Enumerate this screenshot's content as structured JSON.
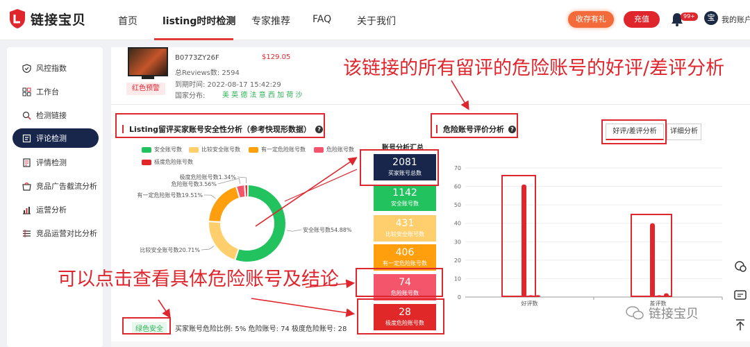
{
  "brand": {
    "name": "链接宝贝"
  },
  "nav": {
    "items": [
      "首页",
      "listing时时检测",
      "专家推荐",
      "FAQ",
      "关于我们"
    ],
    "save_label": "收存有礼",
    "charge_label": "充值",
    "badge": "99+",
    "avatar_char": "宝",
    "account_label": "我的账户"
  },
  "sidebar": {
    "items": [
      "风控指数",
      "工作台",
      "检测链接",
      "评论检测",
      "评情检测",
      "竞品广告截流分析",
      "运营分析",
      "竞品运营对比分析"
    ],
    "active_index": 3
  },
  "product": {
    "asin": "B0773ZY26F",
    "price": "$129.05",
    "reviews": "总Reviews数: 2594",
    "date": "到期时间: 2022-08-17 15:42:29",
    "country": "国家分布:",
    "flags": "美 英 德 法 意 西 加 荷 沙",
    "warning_tag": "红色预警"
  },
  "section_left": {
    "title": "Listing留评买家账号安全性分析（参考快现形数据）",
    "help": "?"
  },
  "section_right": {
    "title": "危险账号评价分析",
    "help": "?",
    "tab_good_bad": "好评/差评分析",
    "tab_detail": "详细分析"
  },
  "colors": {
    "safe": "#22c35e",
    "fairly_safe": "#ffcf6e",
    "some_risk": "#ff9f0e",
    "risk": "#f5556b",
    "extreme": "#e02828",
    "total": "#17264a",
    "accent": "#e0262d"
  },
  "chart_data": [
    {
      "type": "pie",
      "legend": [
        "安全账号数",
        "比较安全账号数",
        "有一定危险账号数",
        "危险账号数",
        "极度危险账号数"
      ],
      "slices": [
        {
          "label": "安全账号数",
          "value": 54.88,
          "text": "安全账号数54.88%"
        },
        {
          "label": "比较安全账号数",
          "value": 20.71,
          "text": "比较安全账号数20.71%"
        },
        {
          "label": "有一定危险账号数",
          "value": 19.51,
          "text": "有一定危险账号数19.51%"
        },
        {
          "label": "危险账号数",
          "value": 3.56,
          "text": "危险账号数3.56%"
        },
        {
          "label": "极度危险账号数",
          "value": 1.34,
          "text": "极度危险账号数1.34%"
        }
      ]
    },
    {
      "type": "bar",
      "categories": [
        "好评数",
        "差评数"
      ],
      "series": [
        {
          "values": [
            61,
            40
          ]
        },
        {
          "values": [
            1,
            1
          ]
        },
        {
          "values": [
            1,
            2
          ]
        }
      ],
      "yticks": [
        0,
        10,
        20,
        30,
        40,
        50,
        60,
        70
      ],
      "ylim": [
        0,
        70
      ]
    }
  ],
  "summary": {
    "title": "账号分析汇总",
    "boxes": [
      {
        "value": "2081",
        "label": "买家账号总数"
      },
      {
        "value": "1142",
        "label": "安全账号数"
      },
      {
        "value": "431",
        "label": "比较安全账号数"
      },
      {
        "value": "406",
        "label": "有一定危险账号数"
      },
      {
        "value": "74",
        "label": "危险账号数"
      },
      {
        "value": "28",
        "label": "极度危险账号数"
      }
    ]
  },
  "status": {
    "label": "绿色安全",
    "text": "买家账号危险比例: 5%  危险账号: 74  极度危险账号: 28"
  },
  "annotations": {
    "top": "该链接的所有留评的危险账号的好评/差评分析",
    "bottom": "可以点击查看具体危险账号及结论"
  },
  "watermark": {
    "text": "链接宝贝"
  }
}
